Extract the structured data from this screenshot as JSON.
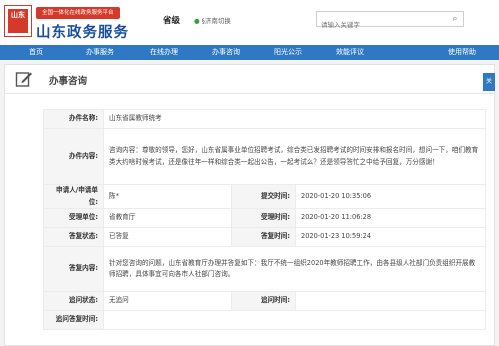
{
  "header": {
    "logo_text": "山东",
    "tagline": "全国一体化在线政务服务平台",
    "site_title": "山东政务服务",
    "level": "省级",
    "location": "§济南切换",
    "search_placeholder": "请输入关键字"
  },
  "nav": {
    "items": [
      "首页",
      "办事服务",
      "在线办理",
      "办事咨询",
      "阳光公示",
      "效能评议",
      "使用帮助"
    ]
  },
  "panel": {
    "title": "办事咨询",
    "side_tab": "关"
  },
  "detail": {
    "labels": {
      "item_name": "办件名称:",
      "item_content": "办件内容:",
      "applicant": "申请人/申请单位:",
      "submit_time": "提交时间:",
      "handler": "受理单位:",
      "handle_time": "受理时间:",
      "reply_status": "答复状态:",
      "reply_time": "答复时间:",
      "reply_content": "答复内容:",
      "followup_status": "追问状态:",
      "followup_time": "追问时间:",
      "followup_reply_time": "追问答复时间:"
    },
    "values": {
      "item_name": "山东省属教师统考",
      "item_content": "咨询内容：尊敬的领导，您好，山东省属事业单位招聘考试，综合类已发招聘考试的时间安排和报名时间，想问一下，咱们教育类大约啥时候考试，还是像往年一样和综合类一起出公告，一起考试么？还是领导答忙之中给予回复，万分感谢！",
      "applicant": "陈*",
      "submit_time": "2020-01-20 10:35:06",
      "handler": "省教育厅",
      "handle_time": "2020-01-20 11:06:28",
      "reply_status": "已答复",
      "reply_time": "2020-01-23 10:59:24",
      "reply_content": "针对您咨询的问题，山东省教育厅办理并答复如下：我厅不统一组织2020年教师招聘工作，由各县级人社部门负责组织开展教师招聘，具体事宜可向各市人社部门咨询。",
      "followup_status": "无追问",
      "followup_time": "",
      "followup_reply_time": ""
    }
  },
  "colors": {
    "brand_blue": "#1a4f9c",
    "nav_blue": "#2f78c4",
    "seal_red": "#d43a2a"
  }
}
